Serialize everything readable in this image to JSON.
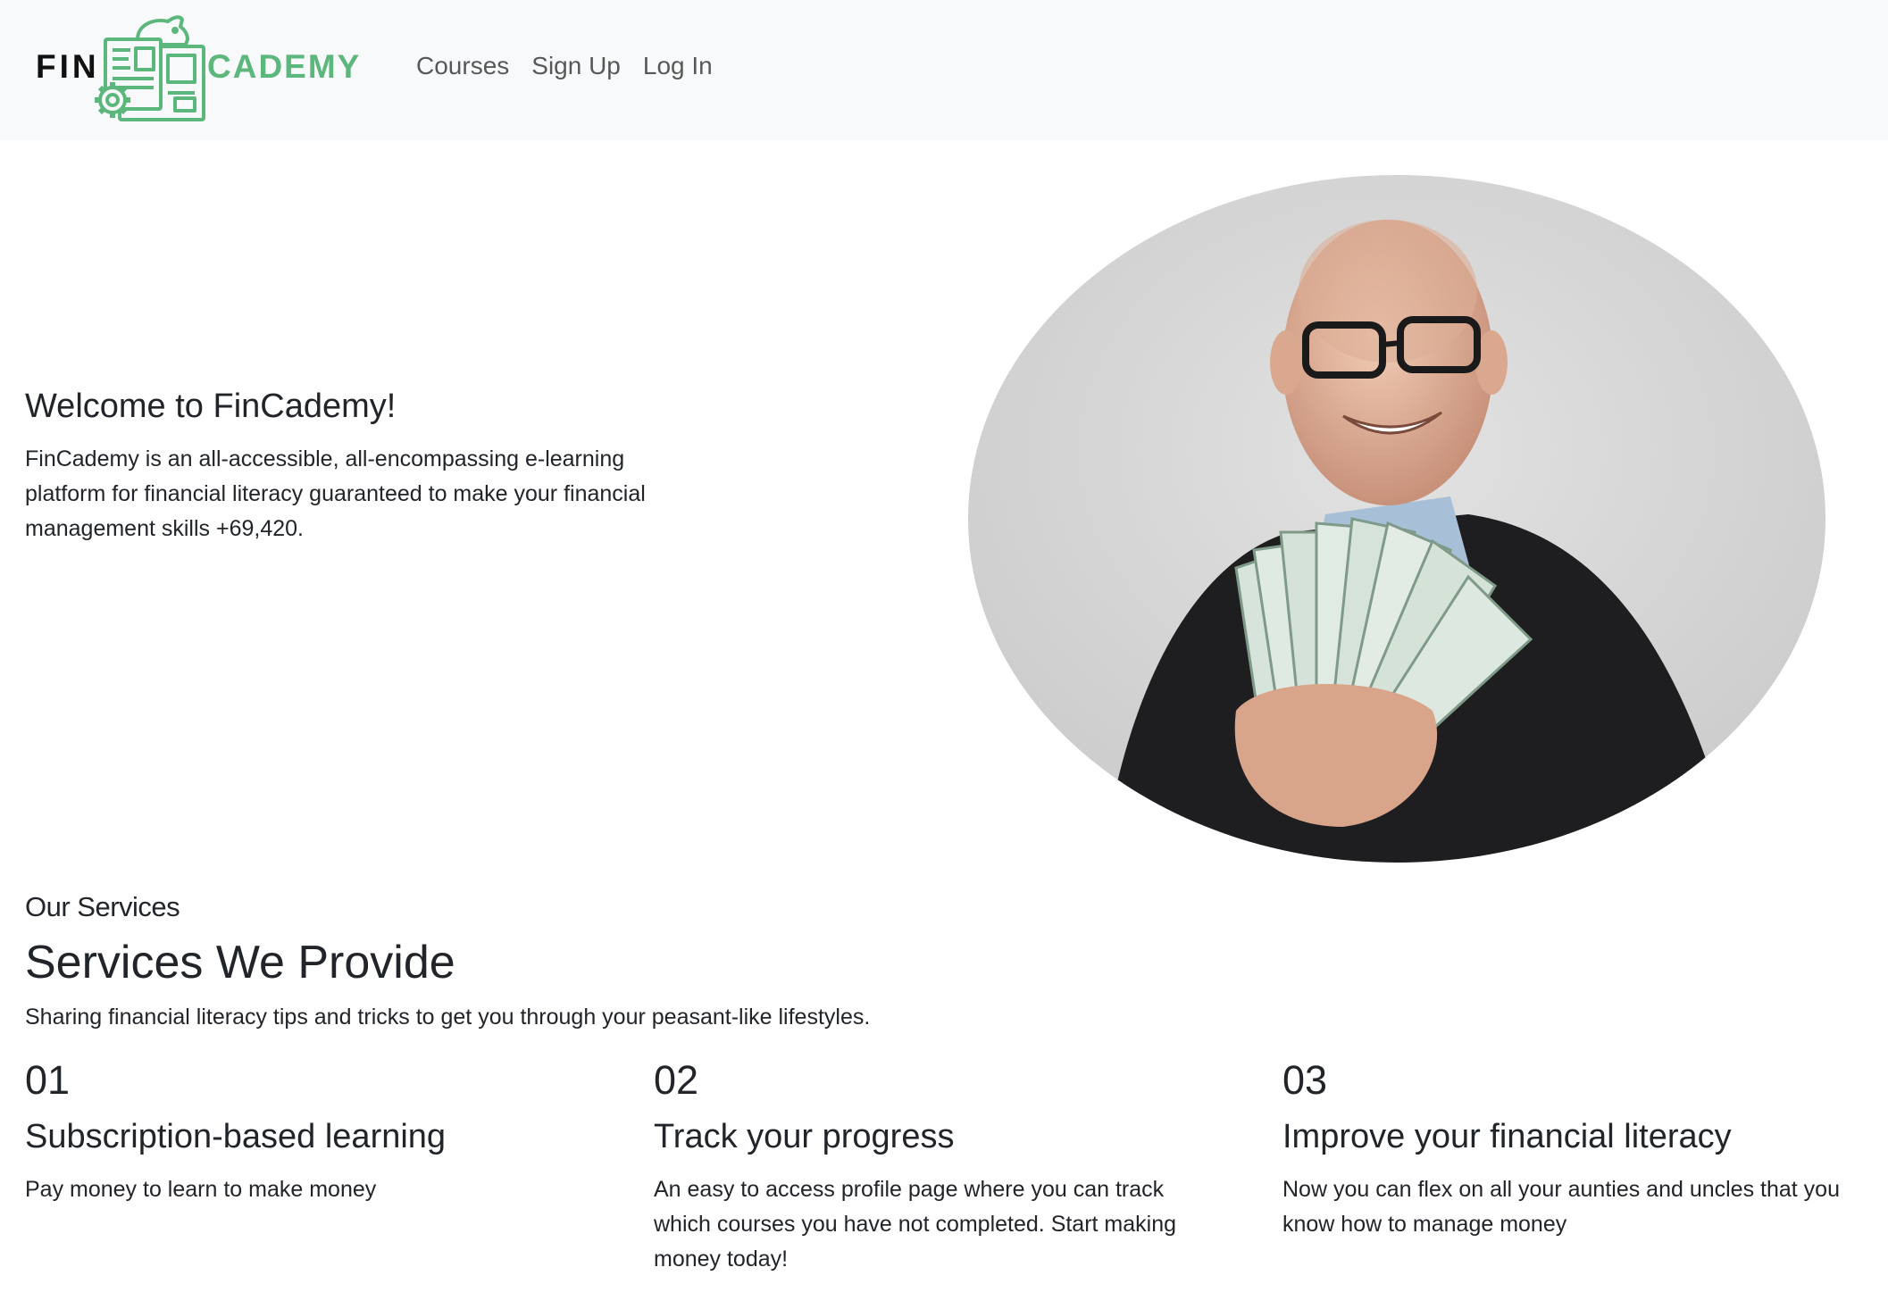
{
  "navbar": {
    "brand": {
      "left": "FIN",
      "right": "CADEMY",
      "logo_icon": "piggy-bank-document-gear-icon"
    },
    "links": [
      {
        "label": "Courses"
      },
      {
        "label": "Sign Up"
      },
      {
        "label": "Log In"
      }
    ]
  },
  "hero": {
    "title": "Welcome to FinCademy!",
    "description": "FinCademy is an all-accessible, all-encompassing e-learning platform for financial literacy guaranteed to make your financial management skills +69,420."
  },
  "services": {
    "eyebrow": "Our Services",
    "title": "Services We Provide",
    "description": "Sharing financial literacy tips and tricks to get you through your peasant-like lifestyles.",
    "items": [
      {
        "number": "01",
        "title": "Subscription-based learning",
        "description": "Pay money to learn to make money"
      },
      {
        "number": "02",
        "title": "Track your progress",
        "description": "An easy to access profile page where you can track which courses you have not completed. Start making money today!"
      },
      {
        "number": "03",
        "title": "Improve your financial literacy",
        "description": "Now you can flex on all your aunties and uncles that you know how to manage money"
      }
    ]
  },
  "colors": {
    "brand_green": "#5cb77c",
    "navbar_bg": "#f8f9fa",
    "text": "#212529"
  }
}
